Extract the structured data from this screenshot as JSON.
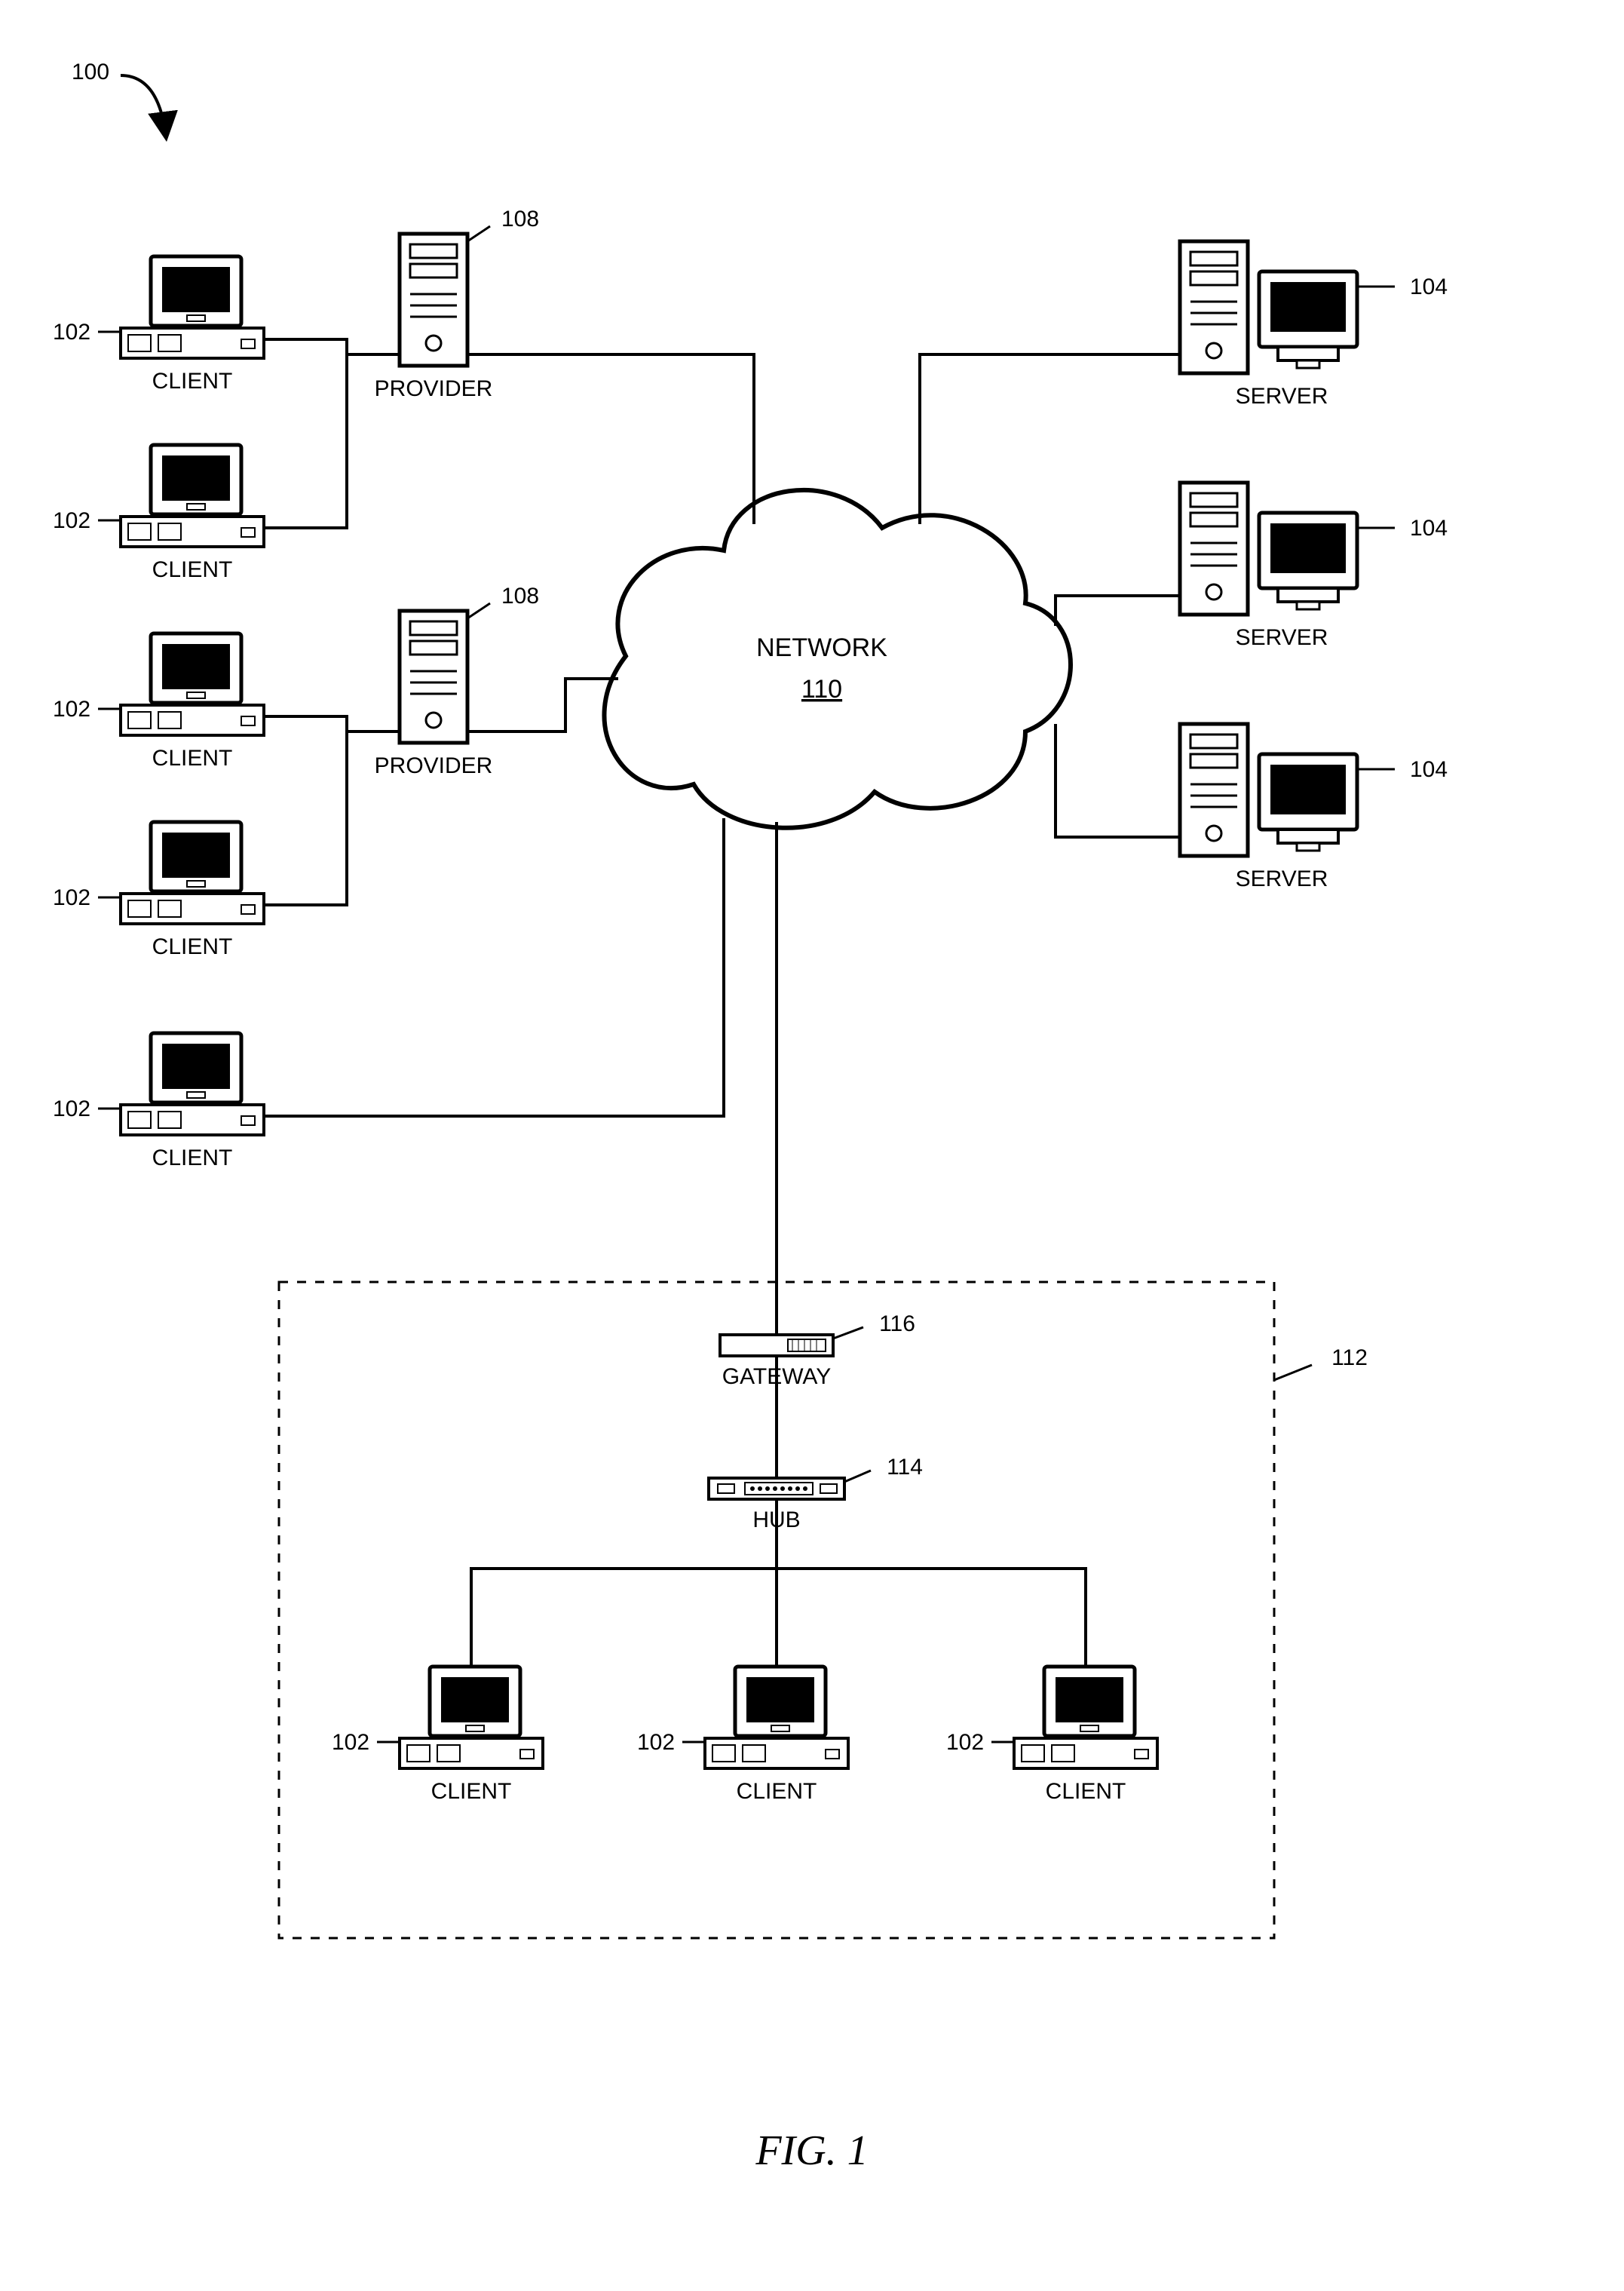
{
  "figure_label": "FIG. 1",
  "system_ref": "100",
  "network": {
    "label": "NETWORK",
    "ref": "110"
  },
  "clients": {
    "label": "CLIENT",
    "ref": "102"
  },
  "providers": {
    "label": "PROVIDER",
    "ref": "108"
  },
  "servers": {
    "label": "SERVER",
    "ref": "104"
  },
  "gateway": {
    "label": "GATEWAY",
    "ref": "116"
  },
  "hub": {
    "label": "HUB",
    "ref": "114"
  },
  "lan_box_ref": "112"
}
